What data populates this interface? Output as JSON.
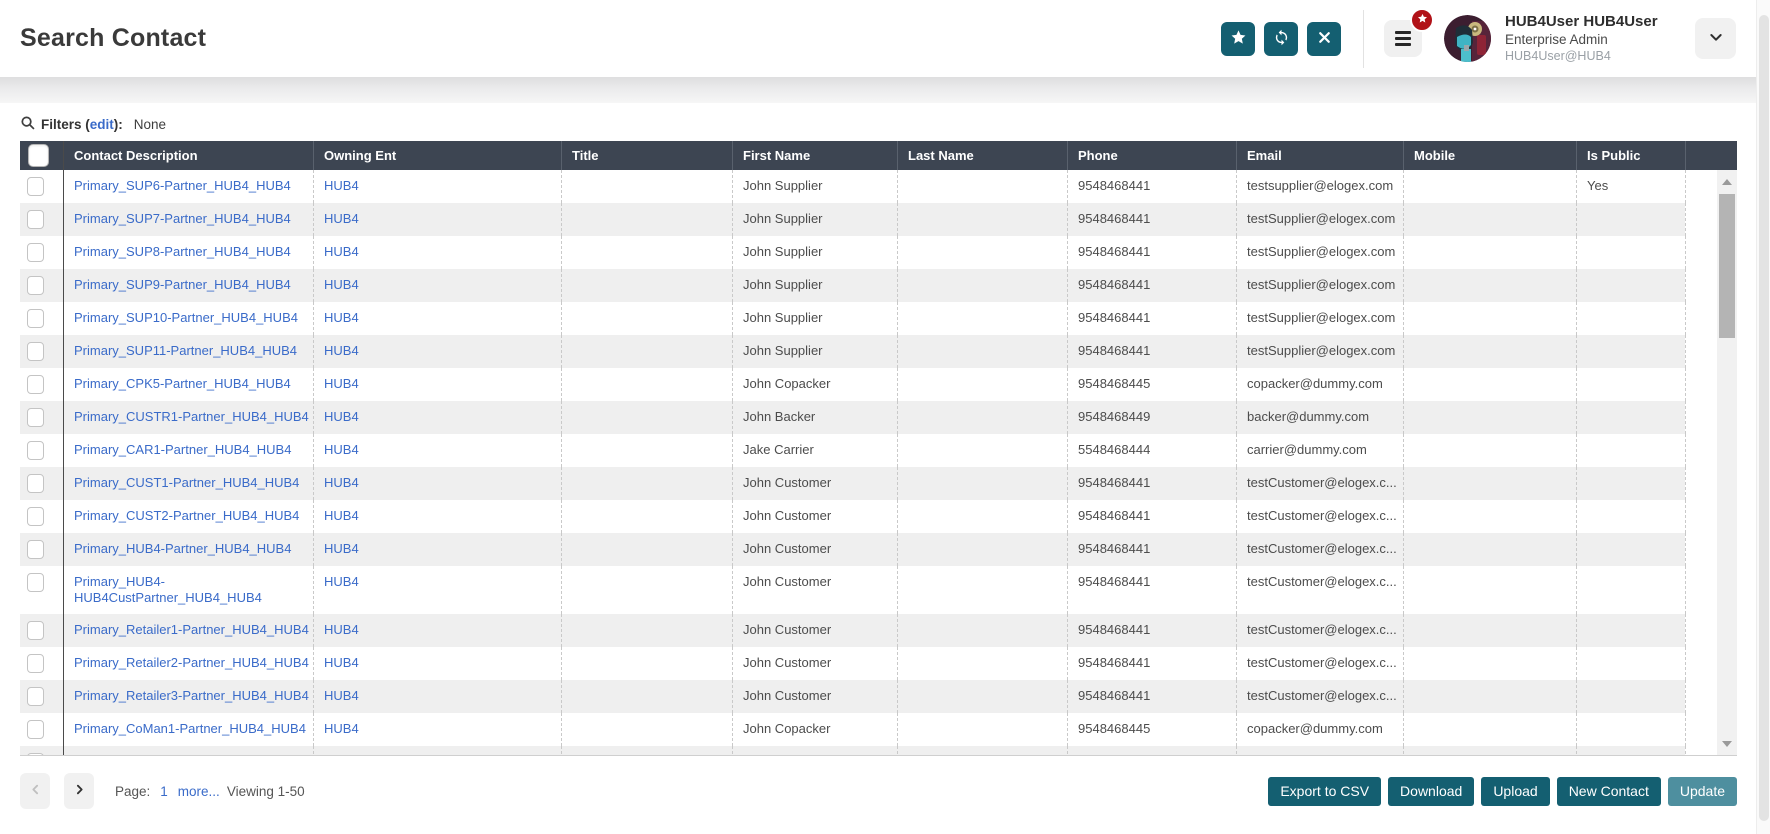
{
  "page": {
    "title": "Search Contact"
  },
  "topbar": {
    "action_icons": [
      "star-icon",
      "sync-icon",
      "x-icon"
    ],
    "menu_icon": "hamburger-icon",
    "menu_badge_icon": "star-badge-icon",
    "user": {
      "name": "HUB4User HUB4User",
      "role": "Enterprise Admin",
      "handle": "HUB4User@HUB4"
    },
    "expand_icon": "chevron-down-icon"
  },
  "filters": {
    "icon": "search-icon",
    "label_prefix": "Filters (",
    "edit_link": "edit",
    "label_suffix": "):",
    "value": "None"
  },
  "table": {
    "columns": [
      "Contact Description",
      "Owning Ent",
      "Title",
      "First Name",
      "Last Name",
      "Phone",
      "Email",
      "Mobile",
      "Is Public"
    ],
    "rows": [
      {
        "desc": "Primary_SUP6-Partner_HUB4_HUB4",
        "owning": "HUB4",
        "title": "",
        "first": "John Supplier",
        "last": "",
        "phone": "9548468441",
        "email": "testsupplier@elogex.com",
        "mobile": "",
        "public": "Yes"
      },
      {
        "desc": "Primary_SUP7-Partner_HUB4_HUB4",
        "owning": "HUB4",
        "title": "",
        "first": "John Supplier",
        "last": "",
        "phone": "9548468441",
        "email": "testSupplier@elogex.com",
        "mobile": "",
        "public": ""
      },
      {
        "desc": "Primary_SUP8-Partner_HUB4_HUB4",
        "owning": "HUB4",
        "title": "",
        "first": "John Supplier",
        "last": "",
        "phone": "9548468441",
        "email": "testSupplier@elogex.com",
        "mobile": "",
        "public": ""
      },
      {
        "desc": "Primary_SUP9-Partner_HUB4_HUB4",
        "owning": "HUB4",
        "title": "",
        "first": "John Supplier",
        "last": "",
        "phone": "9548468441",
        "email": "testSupplier@elogex.com",
        "mobile": "",
        "public": ""
      },
      {
        "desc": "Primary_SUP10-Partner_HUB4_HUB4",
        "owning": "HUB4",
        "title": "",
        "first": "John Supplier",
        "last": "",
        "phone": "9548468441",
        "email": "testSupplier@elogex.com",
        "mobile": "",
        "public": ""
      },
      {
        "desc": "Primary_SUP11-Partner_HUB4_HUB4",
        "owning": "HUB4",
        "title": "",
        "first": "John Supplier",
        "last": "",
        "phone": "9548468441",
        "email": "testSupplier@elogex.com",
        "mobile": "",
        "public": ""
      },
      {
        "desc": "Primary_CPK5-Partner_HUB4_HUB4",
        "owning": "HUB4",
        "title": "",
        "first": "John Copacker",
        "last": "",
        "phone": "9548468445",
        "email": "copacker@dummy.com",
        "mobile": "",
        "public": ""
      },
      {
        "desc": "Primary_CUSTR1-Partner_HUB4_HUB4",
        "owning": "HUB4",
        "title": "",
        "first": "John Backer",
        "last": "",
        "phone": "9548468449",
        "email": "backer@dummy.com",
        "mobile": "",
        "public": ""
      },
      {
        "desc": "Primary_CAR1-Partner_HUB4_HUB4",
        "owning": "HUB4",
        "title": "",
        "first": "Jake Carrier",
        "last": "",
        "phone": "5548468444",
        "email": "carrier@dummy.com",
        "mobile": "",
        "public": ""
      },
      {
        "desc": "Primary_CUST1-Partner_HUB4_HUB4",
        "owning": "HUB4",
        "title": "",
        "first": "John Customer",
        "last": "",
        "phone": "9548468441",
        "email": "testCustomer@elogex.c...",
        "mobile": "",
        "public": ""
      },
      {
        "desc": "Primary_CUST2-Partner_HUB4_HUB4",
        "owning": "HUB4",
        "title": "",
        "first": "John Customer",
        "last": "",
        "phone": "9548468441",
        "email": "testCustomer@elogex.c...",
        "mobile": "",
        "public": ""
      },
      {
        "desc": "Primary_HUB4-Partner_HUB4_HUB4",
        "owning": "HUB4",
        "title": "",
        "first": "John Customer",
        "last": "",
        "phone": "9548468441",
        "email": "testCustomer@elogex.c...",
        "mobile": "",
        "public": ""
      },
      {
        "desc": "Primary_HUB4-HUB4CustPartner_HUB4_HUB4",
        "owning": "HUB4",
        "title": "",
        "first": "John Customer",
        "last": "",
        "phone": "9548468441",
        "email": "testCustomer@elogex.c...",
        "mobile": "",
        "public": ""
      },
      {
        "desc": "Primary_Retailer1-Partner_HUB4_HUB4",
        "owning": "HUB4",
        "title": "",
        "first": "John Customer",
        "last": "",
        "phone": "9548468441",
        "email": "testCustomer@elogex.c...",
        "mobile": "",
        "public": ""
      },
      {
        "desc": "Primary_Retailer2-Partner_HUB4_HUB4",
        "owning": "HUB4",
        "title": "",
        "first": "John Customer",
        "last": "",
        "phone": "9548468441",
        "email": "testCustomer@elogex.c...",
        "mobile": "",
        "public": ""
      },
      {
        "desc": "Primary_Retailer3-Partner_HUB4_HUB4",
        "owning": "HUB4",
        "title": "",
        "first": "John Customer",
        "last": "",
        "phone": "9548468441",
        "email": "testCustomer@elogex.c...",
        "mobile": "",
        "public": ""
      },
      {
        "desc": "Primary_CoMan1-Partner_HUB4_HUB4",
        "owning": "HUB4",
        "title": "",
        "first": "John Copacker",
        "last": "",
        "phone": "9548468445",
        "email": "copacker@dummy.com",
        "mobile": "",
        "public": ""
      },
      {
        "desc": "",
        "owning": "",
        "title": "",
        "first": "",
        "last": "",
        "phone": "",
        "email": "",
        "mobile": "",
        "public": ""
      }
    ]
  },
  "pagination": {
    "label": "Page:",
    "page": "1",
    "more": "more...",
    "viewing": "Viewing 1-50"
  },
  "buttons": [
    "Export to CSV",
    "Download",
    "Upload",
    "New Contact",
    "Update"
  ],
  "colors": {
    "teal": "#145f71",
    "teal_light": "#4e8f9f",
    "link_blue": "#3a6bc9",
    "header_dark": "#3d4552",
    "badge_red": "#b11218",
    "row_stripe": "#efefef"
  }
}
